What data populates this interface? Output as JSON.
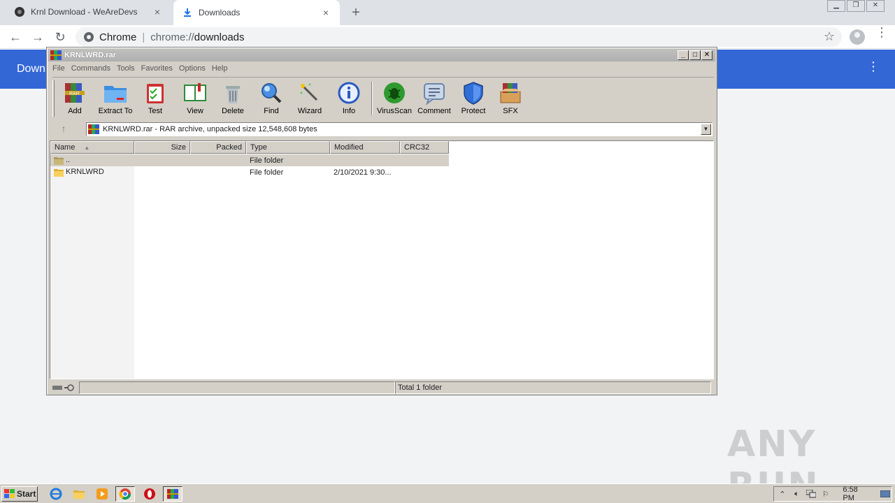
{
  "browser": {
    "tabs": [
      {
        "title": "Krnl Download - WeAreDevs",
        "close": "×",
        "icon": "wearedevs-favicon"
      },
      {
        "title": "Downloads",
        "close": "×",
        "icon": "download-icon"
      }
    ],
    "new_tab": "+",
    "omnibox": {
      "scheme_label": "Chrome",
      "url_prefix": "chrome://",
      "url_host": "downloads"
    },
    "page_title": "Downl"
  },
  "winrar": {
    "title": "KRNLWRD.rar",
    "menu": [
      "File",
      "Commands",
      "Tools",
      "Favorites",
      "Options",
      "Help"
    ],
    "toolbar": [
      "Add",
      "Extract To",
      "Test",
      "View",
      "Delete",
      "Find",
      "Wizard",
      "Info",
      "VirusScan",
      "Comment",
      "Protect",
      "SFX"
    ],
    "address": "KRNLWRD.rar - RAR archive, unpacked size 12,548,608 bytes",
    "columns": [
      "Name",
      "Size",
      "Packed",
      "Type",
      "Modified",
      "CRC32"
    ],
    "rows": [
      {
        "name": "..",
        "size": "",
        "packed": "",
        "type": "File folder",
        "modified": "",
        "crc": ""
      },
      {
        "name": "KRNLWRD",
        "size": "",
        "packed": "",
        "type": "File folder",
        "modified": "2/10/2021 9:30...",
        "crc": ""
      }
    ],
    "status": "Total 1 folder"
  },
  "taskbar": {
    "start": "Start",
    "clock": "6:58 PM",
    "apps": [
      "ie-icon",
      "explorer-icon",
      "media-player-icon",
      "chrome-icon",
      "opera-icon",
      "winrar-icon"
    ]
  },
  "watermark": "ANY RUN",
  "colors": {
    "chrome_header": "#3367d6",
    "classic_face": "#d4d0c8"
  }
}
